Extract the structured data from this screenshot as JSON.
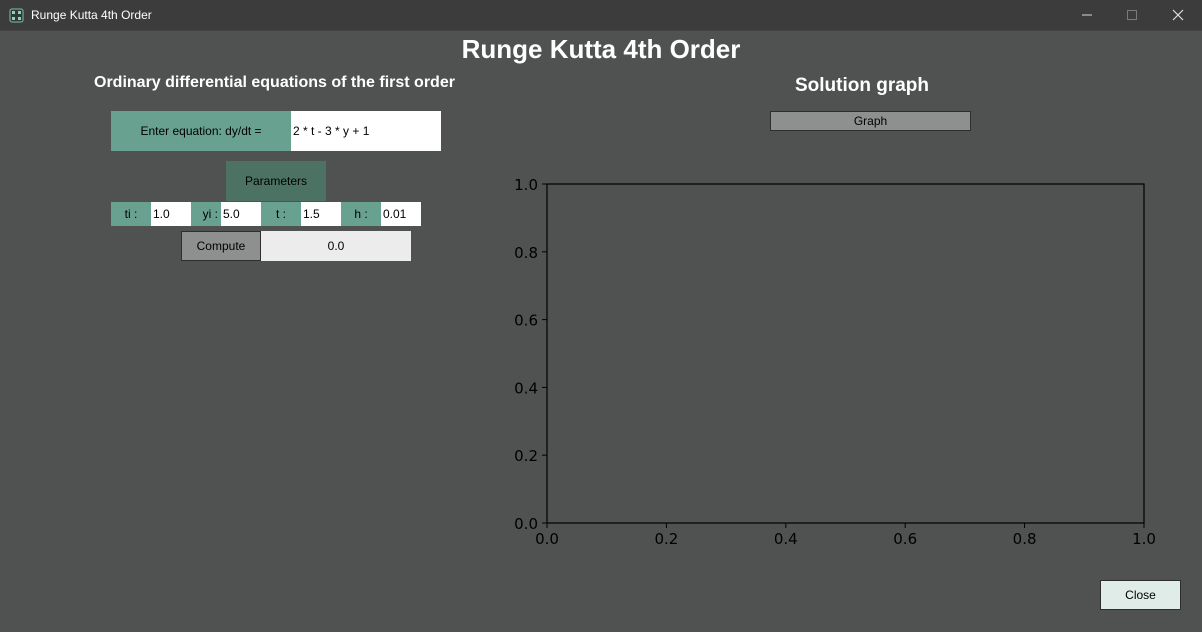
{
  "window": {
    "title": "Runge Kutta 4th Order",
    "controls": {
      "minimize": "—",
      "maximize": "☐",
      "close": "✕"
    }
  },
  "header": {
    "title": "Runge Kutta 4th Order"
  },
  "left_panel": {
    "heading": "Ordinary differential equations of the first order",
    "equation_label": "Enter equation: dy/dt =",
    "equation_value": "2 * t - 3 * y + 1",
    "parameters_label": "Parameters",
    "params": {
      "ti_label": "ti :",
      "ti_value": "1.0",
      "yi_label": "yi :",
      "yi_value": "5.0",
      "t_label": "t :",
      "t_value": "1.5",
      "h_label": "h :",
      "h_value": "0.01"
    },
    "compute_label": "Compute",
    "result": "0.0"
  },
  "right_panel": {
    "heading": "Solution graph",
    "graph_button_label": "Graph"
  },
  "chart_data": {
    "type": "line",
    "title": "",
    "xlabel": "",
    "ylabel": "",
    "series": [],
    "xlim": [
      0.0,
      1.0
    ],
    "ylim": [
      0.0,
      1.0
    ],
    "x_ticks": [
      "0.0",
      "0.2",
      "0.4",
      "0.6",
      "0.8",
      "1.0"
    ],
    "y_ticks": [
      "0.0",
      "0.2",
      "0.4",
      "0.6",
      "0.8",
      "1.0"
    ],
    "grid": false
  },
  "footer": {
    "close_label": "Close"
  },
  "colors": {
    "background": "#505252",
    "titlebar": "#3c3c3c",
    "label_green": "#68a190",
    "params_green": "#4b7263",
    "button_gray": "#8d908f",
    "close_button": "#e0ece8"
  },
  "icons": {
    "app": "app-icon",
    "minimize": "minimize-icon",
    "maximize": "maximize-icon",
    "close": "close-icon"
  }
}
